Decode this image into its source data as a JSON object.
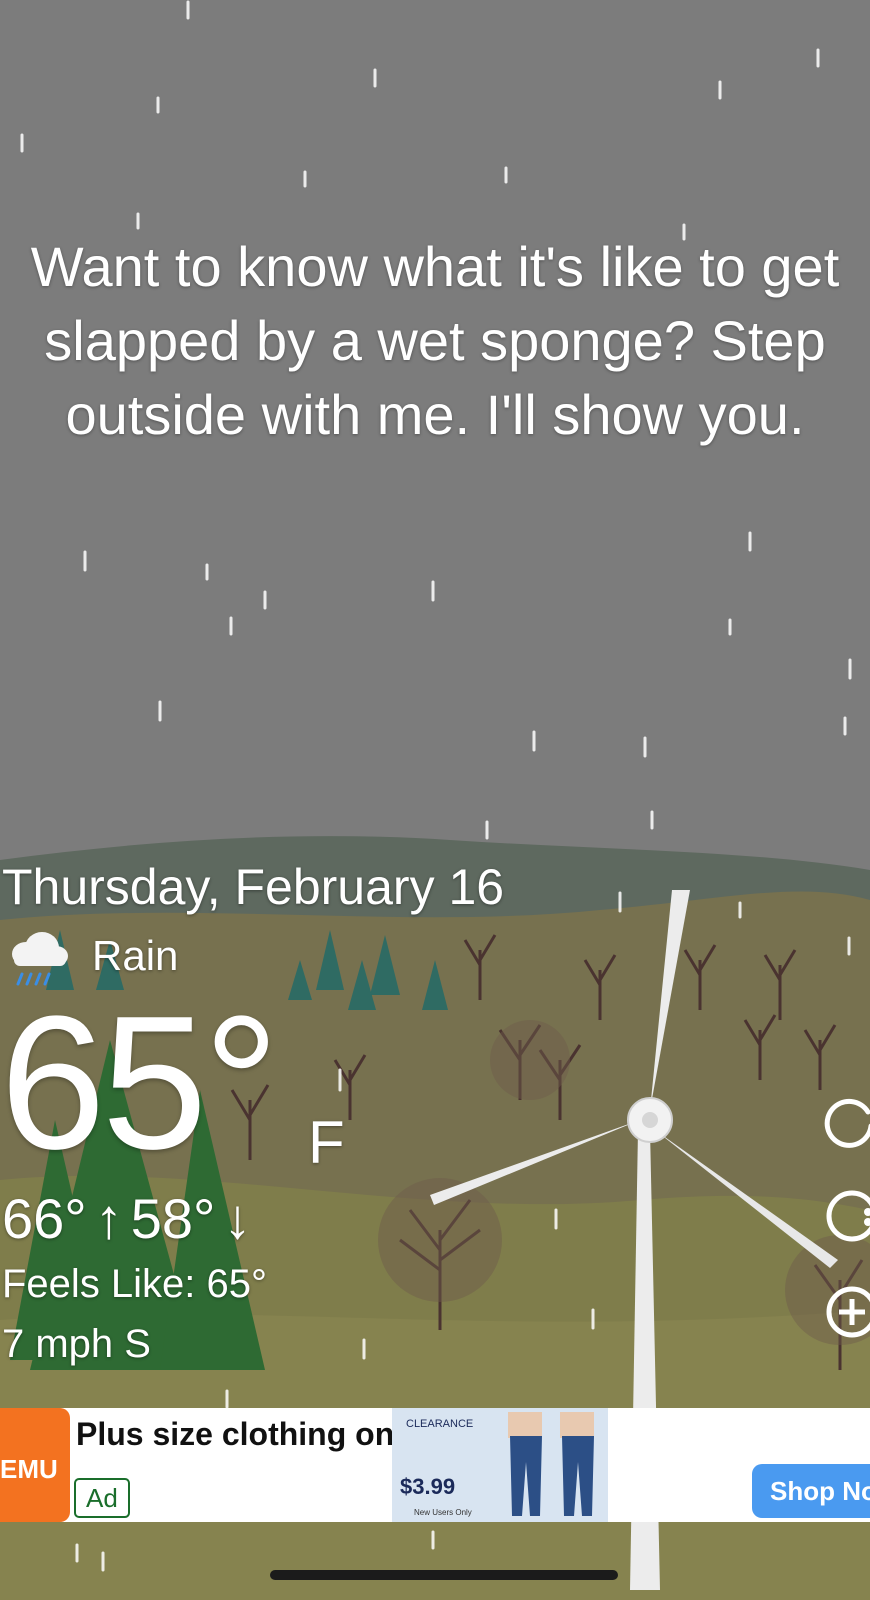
{
  "quote": "Want to know what it's like to get slapped by a wet sponge? Step outside with me. I'll show you.",
  "weather": {
    "date": "Thursday, February 16",
    "condition": "Rain",
    "condition_icon": "rain-cloud-icon",
    "temperature": "65°",
    "unit": "F",
    "high": "66°",
    "low": "58°",
    "feels_like": "Feels Like: 65°",
    "wind": "7 mph S"
  },
  "side_buttons": [
    "refresh-icon",
    "palette-icon",
    "add-icon"
  ],
  "ad": {
    "brand_logo_text": "EMU",
    "title": "Plus size clothing on sale",
    "badge": "Ad",
    "image_clearance": "CLEARANCE",
    "image_price": "$3.99",
    "image_note": "New Users Only",
    "cta": "Shop Now"
  },
  "colors": {
    "sky": "#7c7c7c",
    "hill_dark": "#5d6a5f",
    "ground": "#7a7a52",
    "ad_brand": "#f37220",
    "cta": "#4a9af0"
  }
}
